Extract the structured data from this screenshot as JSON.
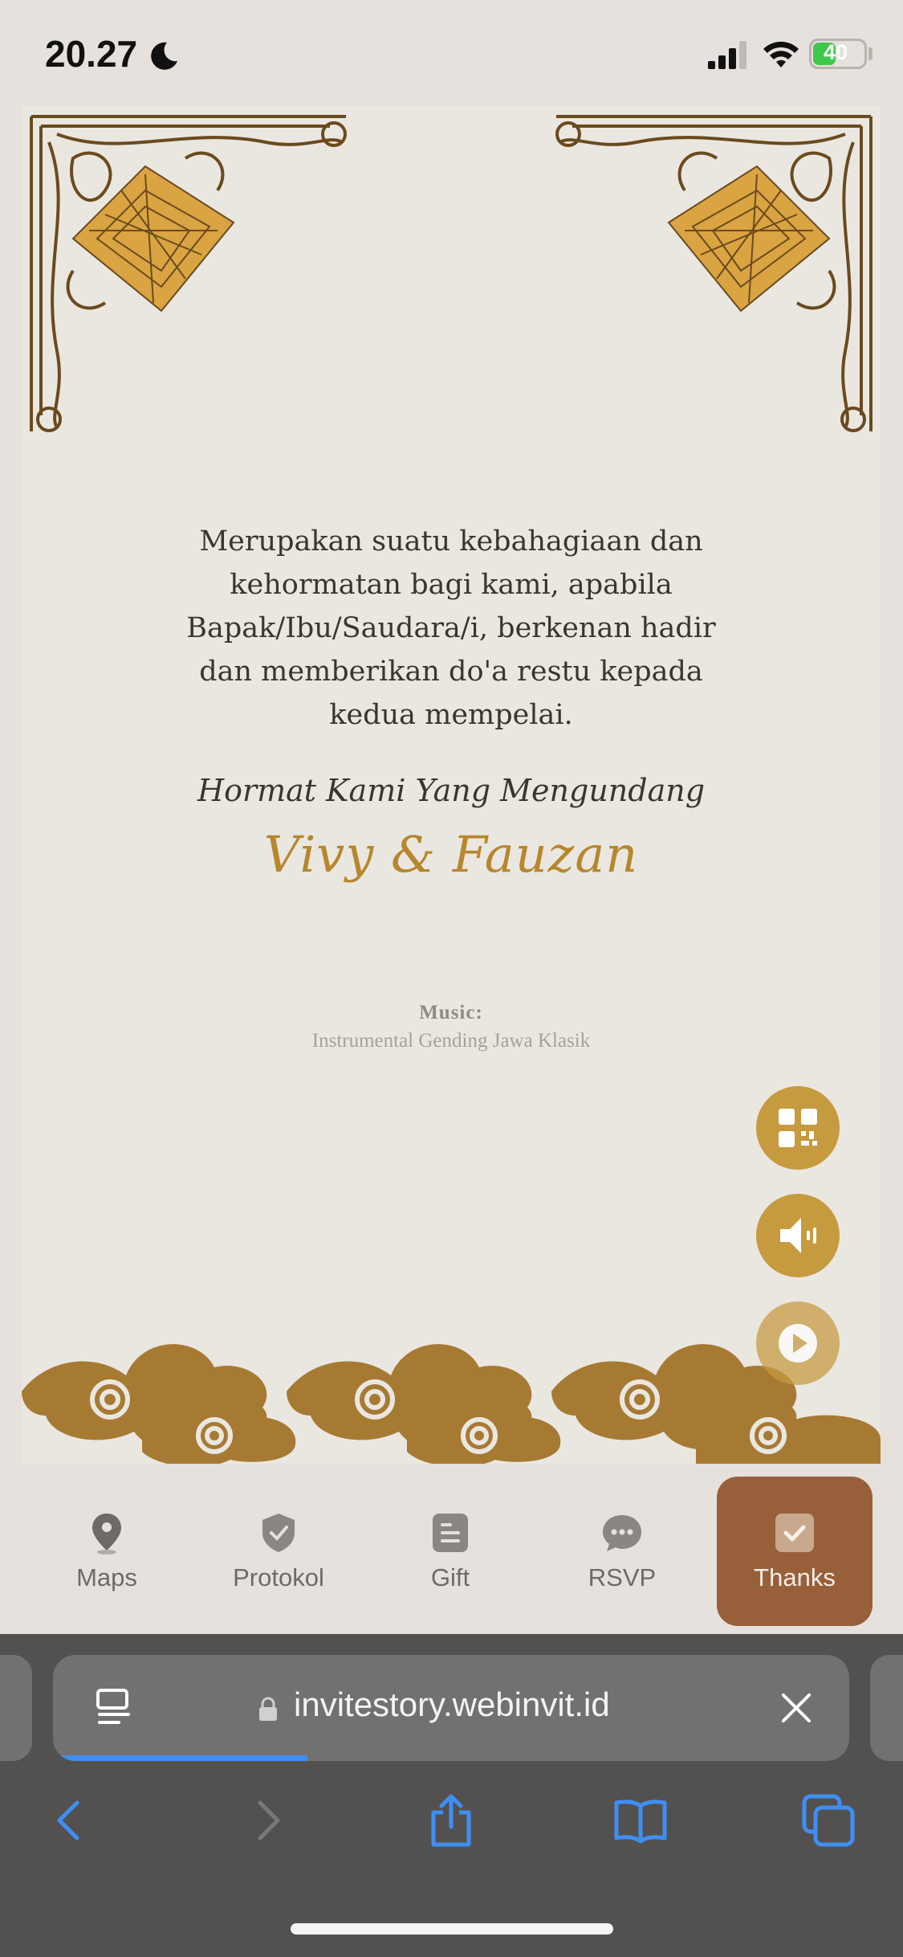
{
  "status_bar": {
    "time": "20.27",
    "battery_percent": "40"
  },
  "invitation": {
    "message": "Merupakan suatu kebahagiaan dan kehormatan bagi kami, apabila Bapak/Ibu/Saudara/i, berkenan hadir dan memberikan do'a restu kepada kedua mempelai.",
    "greeting": "Hormat Kami Yang Mengundang",
    "couple": "Vivy & Fauzan",
    "music_label": "Music:",
    "music_title": "Instrumental Gending Jawa Klasik",
    "accent_color": "#c69a3f",
    "ornament_color": "#b7872c"
  },
  "floating_buttons": [
    {
      "icon": "qr-code-icon"
    },
    {
      "icon": "speaker-icon"
    },
    {
      "icon": "play-icon"
    }
  ],
  "bottom_nav": {
    "items": [
      {
        "label": "Maps",
        "icon": "map-pin-icon"
      },
      {
        "label": "Protokol",
        "icon": "shield-check-icon"
      },
      {
        "label": "Gift",
        "icon": "gift-document-icon"
      },
      {
        "label": "RSVP",
        "icon": "chat-bubble-icon"
      },
      {
        "label": "Thanks",
        "icon": "check-square-icon",
        "active": true
      }
    ],
    "active_color": "#98603a"
  },
  "browser": {
    "url": "invitestory.webinvit.id",
    "load_progress": 0.32
  }
}
